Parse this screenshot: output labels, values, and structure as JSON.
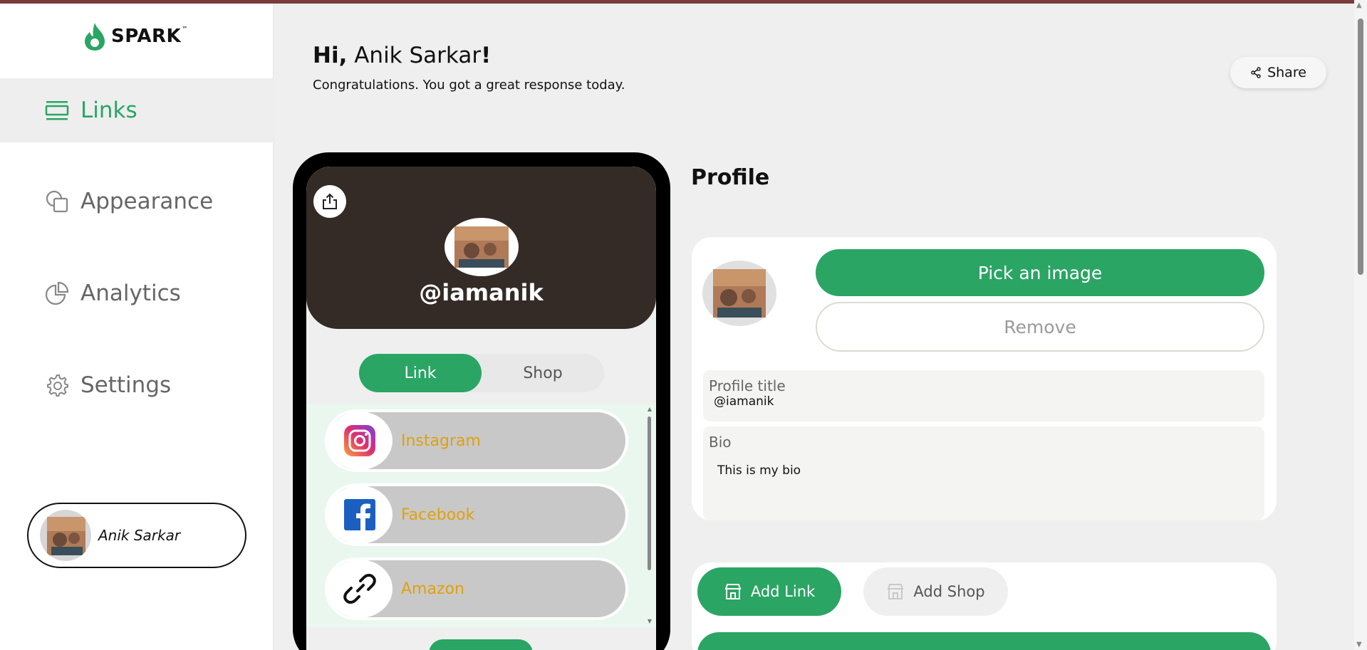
{
  "app": {
    "brand": "SPARK",
    "brand_tm": "™"
  },
  "sidebar": {
    "items": [
      {
        "label": "Links",
        "icon": "links-icon",
        "active": true
      },
      {
        "label": "Appearance",
        "icon": "shapes-icon",
        "active": false
      },
      {
        "label": "Analytics",
        "icon": "pie-chart-icon",
        "active": false
      },
      {
        "label": "Settings",
        "icon": "gear-icon",
        "active": false
      }
    ],
    "user": {
      "name": "Anik Sarkar"
    }
  },
  "header": {
    "greeting_hi": "Hi,",
    "greeting_name": "Anik Sarkar",
    "greeting_end": "!",
    "subtitle": "Congratulations. You got a great response today.",
    "share_label": "Share"
  },
  "phone": {
    "handle": "@iamanik",
    "toggle": {
      "link": "Link",
      "shop": "Shop"
    },
    "links": [
      {
        "label": "Instagram",
        "icon": "instagram-icon"
      },
      {
        "label": "Facebook",
        "icon": "facebook-icon"
      },
      {
        "label": "Amazon",
        "icon": "chain-link-icon"
      }
    ]
  },
  "profile": {
    "section_title": "Profile",
    "pick_image_label": "Pick an image",
    "remove_label": "Remove",
    "title_label": "Profile title",
    "title_value": "@iamanik",
    "bio_label": "Bio",
    "bio_value": "This is my bio"
  },
  "links_panel": {
    "add_link_label": "Add Link",
    "add_shop_label": "Add Shop"
  },
  "colors": {
    "accent": "#2aa564",
    "header_dark": "#342b26",
    "link_text": "#e0a10b"
  }
}
